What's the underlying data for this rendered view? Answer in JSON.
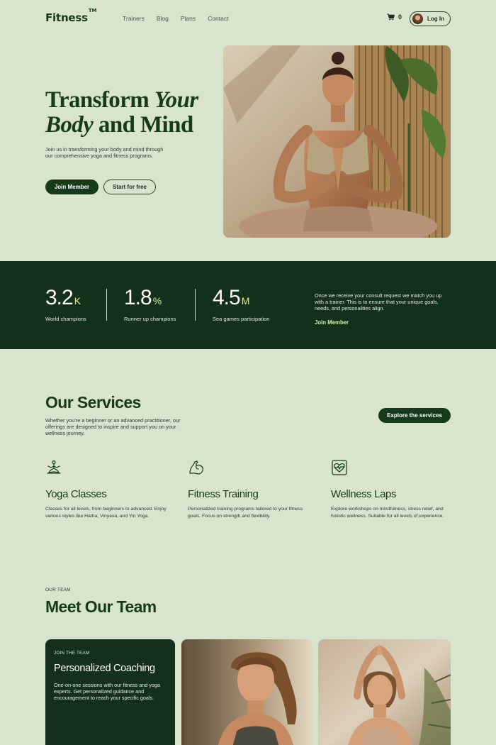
{
  "nav": {
    "logo": "Fitness",
    "trademark": "TM",
    "links": [
      "Trainers",
      "Blog",
      "Plans",
      "Contact"
    ],
    "cart_count": "0",
    "login_label": "Log In"
  },
  "hero": {
    "title_line1_plain": "Transform ",
    "title_line1_italic": "Your",
    "title_line2_italic": "Body",
    "title_line2_plain": " and Mind",
    "description": "Join us in transforming your body and mind through our comprehensive yoga and fitness programs.",
    "primary_button": "Join Member",
    "secondary_button": "Start for free"
  },
  "stats": {
    "items": [
      {
        "value": "3.2",
        "unit": "K",
        "label": "World champions"
      },
      {
        "value": "1.8",
        "unit": "%",
        "label": "Runner up champions"
      },
      {
        "value": "4.5",
        "unit": "M",
        "label": "Sea games participation"
      }
    ],
    "text": "Once we receive your consult request we match you up with a trainer. This is to ensure that your unique goals, needs, and personalities align.",
    "link": "Join Member"
  },
  "services": {
    "title": "Our Services",
    "description": "Whether you're a beginner or an advanced practitioner, our offerings are designed to inspire and support you on your wellness journey.",
    "button": "Explore the services",
    "items": [
      {
        "icon": "meditation-icon",
        "title": "Yoga Classes",
        "description": "Classes for all levels, from beginners to advanced. Enjoy various styles like Hatha, Vinyasa, and Yin Yoga."
      },
      {
        "icon": "muscle-icon",
        "title": "Fitness Training",
        "description": "Personalized training programs tailored to your fitness goals. Focus on strength and flexibility."
      },
      {
        "icon": "heart-pulse-icon",
        "title": "Wellness Laps",
        "description": "Explore workshops on mindfulness, stress relief, and holistic wellness. Suitable for all levels of experience."
      }
    ]
  },
  "team": {
    "eyebrow": "OUR TEAM",
    "title": "Meet Our Team",
    "card": {
      "eyebrow": "JOIN THE TEAM",
      "title": "Personalized Coaching",
      "description": "One-on-one sessions with our fitness and yoga experts. Get personalized guidance and encouragement to reach your specific goals."
    }
  },
  "colors": {
    "background": "#d9e4cf",
    "dark_green": "#13301a",
    "accent_lime": "#d7ef9d"
  }
}
